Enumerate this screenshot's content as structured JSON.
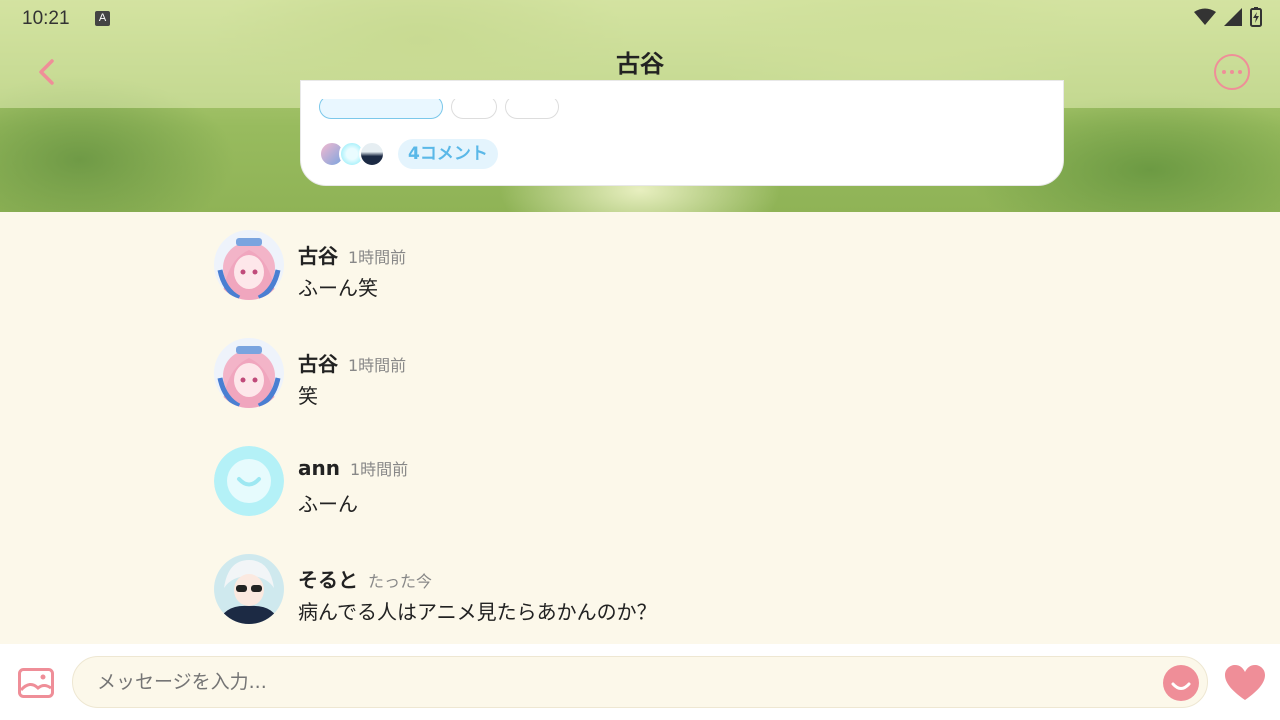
{
  "status_bar": {
    "time": "10:21",
    "keyboard_badge": "A"
  },
  "header": {
    "title": "古谷",
    "subtitle": "4コメント"
  },
  "post_card": {
    "comment_count_label": "4コメント"
  },
  "comments": [
    {
      "name": "古谷",
      "time": "1時間前",
      "text": "ふーん笑",
      "avatar": "pink-hair-avatar"
    },
    {
      "name": "古谷",
      "time": "1時間前",
      "text": "笑",
      "avatar": "pink-hair-avatar"
    },
    {
      "name": "ann",
      "time": "1時間前",
      "text": "ふーん",
      "avatar": "smiley-avatar"
    },
    {
      "name": "そると",
      "time": "たった今",
      "text": "病んでる人はアニメ見たらあかんのか？",
      "avatar": "white-hair-avatar"
    }
  ],
  "composer": {
    "placeholder": "メッセージを入力..."
  },
  "colors": {
    "accent_pink": "#ef8e98",
    "accent_blue": "#5ab8e8",
    "background": "#fcf8ea"
  }
}
